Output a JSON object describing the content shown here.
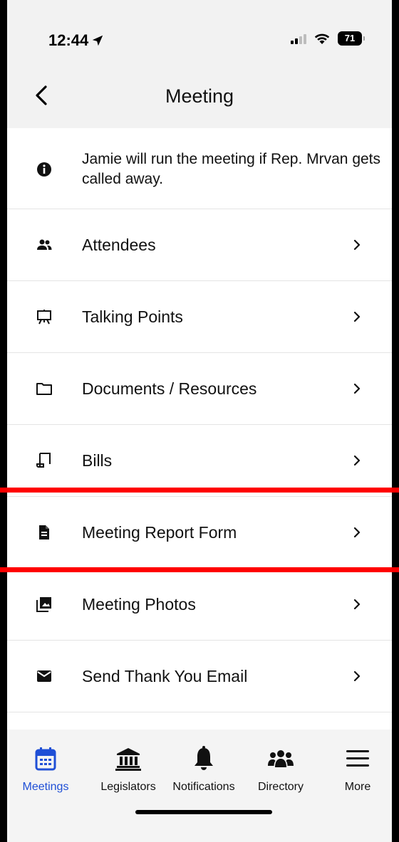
{
  "status_bar": {
    "time": "12:44",
    "battery": "71"
  },
  "header": {
    "title": "Meeting",
    "back_icon": "chevron-left-icon"
  },
  "info": {
    "text": "Jamie will run the meeting if Rep. Mrvan gets called away.",
    "icon": "info-icon"
  },
  "menu": {
    "items": [
      {
        "label": "Attendees",
        "icon": "people-icon"
      },
      {
        "label": "Talking Points",
        "icon": "easel-icon"
      },
      {
        "label": "Documents / Resources",
        "icon": "folder-icon"
      },
      {
        "label": "Bills",
        "icon": "scroll-icon"
      },
      {
        "label": "Meeting Report Form",
        "icon": "document-icon"
      },
      {
        "label": "Meeting Photos",
        "icon": "photos-icon"
      },
      {
        "label": "Send Thank You Email",
        "icon": "envelope-icon"
      }
    ]
  },
  "tab_bar": {
    "tabs": [
      {
        "label": "Meetings",
        "icon": "calendar-icon",
        "active": true
      },
      {
        "label": "Legislators",
        "icon": "capitol-icon",
        "active": false
      },
      {
        "label": "Notifications",
        "icon": "bell-icon",
        "active": false
      },
      {
        "label": "Directory",
        "icon": "group-icon",
        "active": false
      },
      {
        "label": "More",
        "icon": "hamburger-icon",
        "active": false
      }
    ]
  },
  "colors": {
    "accent": "#1f4fd6",
    "highlight": "#ff0000",
    "header_bg": "#f2f2f2"
  }
}
